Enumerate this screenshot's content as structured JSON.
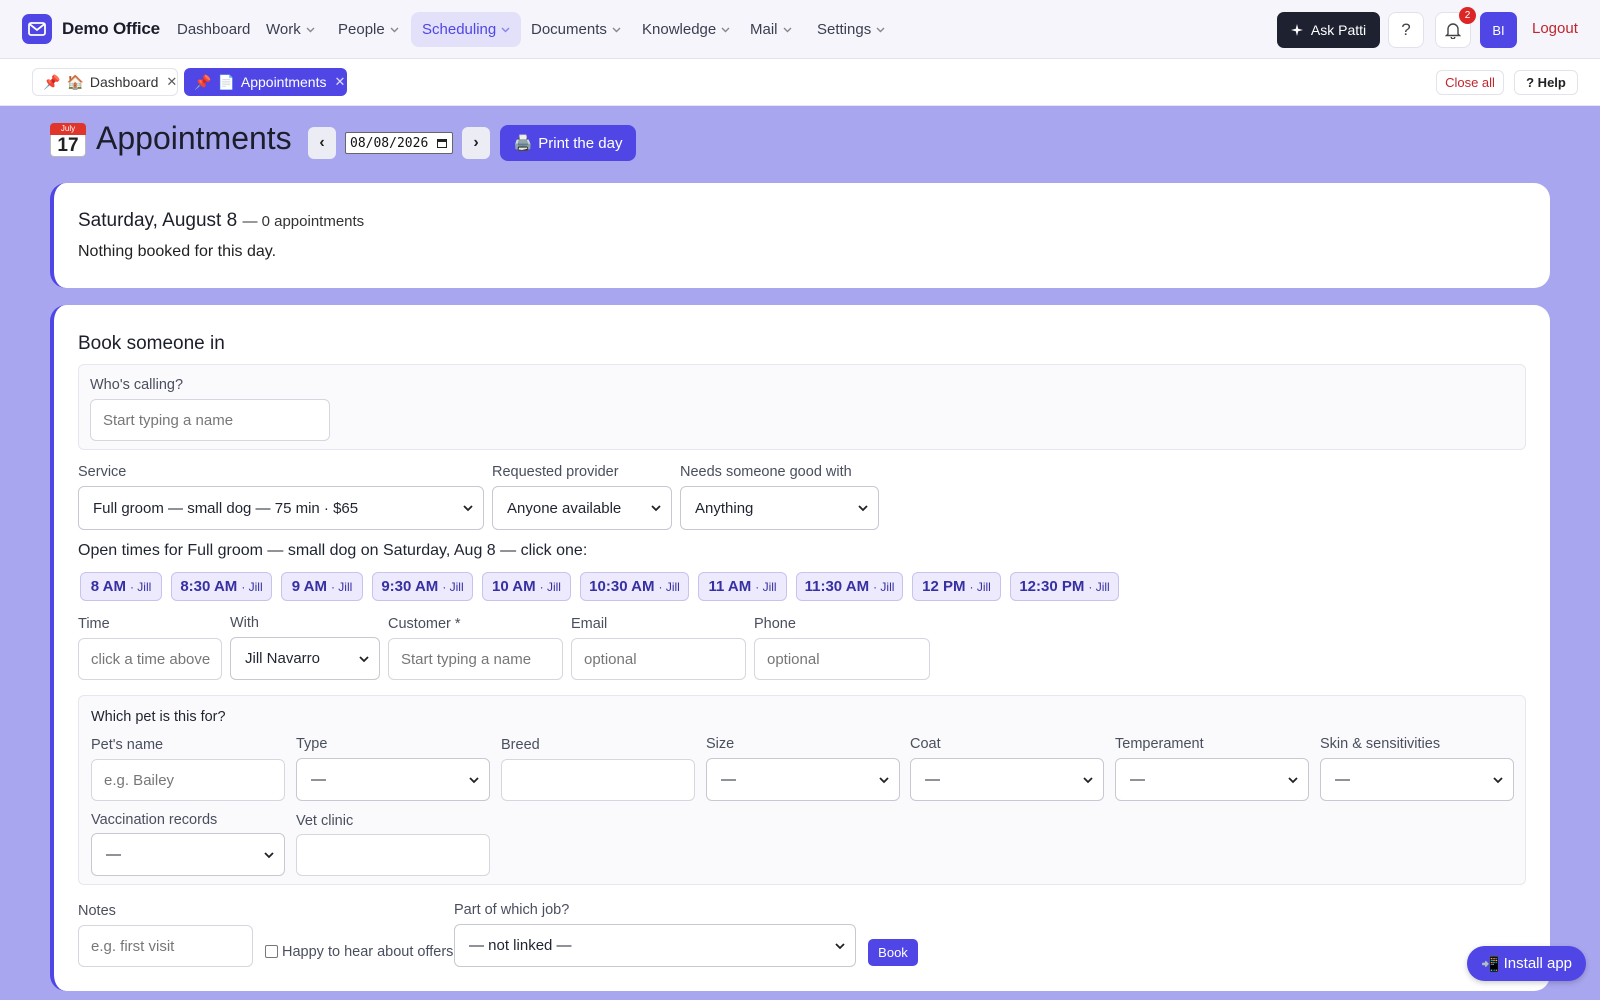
{
  "brand": {
    "name": "Demo Office"
  },
  "nav": {
    "items": [
      {
        "label": "Dashboard",
        "has_menu": false
      },
      {
        "label": "Work",
        "has_menu": true
      },
      {
        "label": "People",
        "has_menu": true
      },
      {
        "label": "Scheduling",
        "has_menu": true,
        "active": true
      },
      {
        "label": "Documents",
        "has_menu": true
      },
      {
        "label": "Knowledge",
        "has_menu": true
      },
      {
        "label": "Mail",
        "has_menu": true
      },
      {
        "label": "Settings",
        "has_menu": true
      }
    ],
    "ask_label": "Ask Patti",
    "help_glyph": "?",
    "notification_count": "2",
    "avatar_initials": "BI",
    "logout_label": "Logout"
  },
  "tabs": {
    "items": [
      {
        "pin": "📌",
        "icon": "🏠",
        "label": "Dashboard",
        "close": "✕"
      },
      {
        "pin": "📌",
        "icon": "📄",
        "label": "Appointments",
        "close": "✕",
        "active": true
      }
    ],
    "close_all_label": "Close all",
    "help_label": "? Help"
  },
  "header": {
    "cal_month": "July",
    "cal_day": "17",
    "title": "Appointments",
    "prev": "‹",
    "next": "›",
    "date_value": "08/08/2026",
    "print_icon": "🖨️",
    "print_label": "Print the day"
  },
  "day_summary": {
    "date": "Saturday, August 8",
    "count": "— 0 appointments",
    "empty_text": "Nothing booked for this day."
  },
  "booking": {
    "title": "Book someone in",
    "caller_label": "Who's calling?",
    "caller_placeholder": "Start typing a name",
    "service_label": "Service",
    "service_value": "Full groom — small dog — 75 min · $65",
    "provider_label": "Requested provider",
    "provider_value": "Anyone available",
    "needs_label": "Needs someone good with",
    "needs_value": "Anything",
    "open_times_text": "Open times for Full groom — small dog on Saturday, Aug 8 — click one:",
    "slots": [
      {
        "time": "8 AM",
        "who": "· Jill"
      },
      {
        "time": "8:30 AM",
        "who": "· Jill"
      },
      {
        "time": "9 AM",
        "who": "· Jill"
      },
      {
        "time": "9:30 AM",
        "who": "· Jill"
      },
      {
        "time": "10 AM",
        "who": "· Jill"
      },
      {
        "time": "10:30 AM",
        "who": "· Jill"
      },
      {
        "time": "11 AM",
        "who": "· Jill"
      },
      {
        "time": "11:30 AM",
        "who": "· Jill"
      },
      {
        "time": "12 PM",
        "who": "· Jill"
      },
      {
        "time": "12:30 PM",
        "who": "· Jill"
      }
    ],
    "time_label": "Time",
    "time_placeholder": "click a time above",
    "with_label": "With",
    "with_value": "Jill Navarro",
    "customer_label": "Customer *",
    "customer_placeholder": "Start typing a name",
    "email_label": "Email",
    "email_placeholder": "optional",
    "phone_label": "Phone",
    "phone_placeholder": "optional",
    "pet": {
      "title": "Which pet is this for?",
      "name_label": "Pet's name",
      "name_placeholder": "e.g. Bailey",
      "type_label": "Type",
      "breed_label": "Breed",
      "size_label": "Size",
      "coat_label": "Coat",
      "temperament_label": "Temperament",
      "skin_label": "Skin & sensitivities",
      "vacc_label": "Vaccination records",
      "vet_label": "Vet clinic",
      "empty_option": "—"
    },
    "notes_label": "Notes",
    "notes_placeholder": "e.g. first visit",
    "offers_label": "Happy to hear about offers",
    "job_label": "Part of which job?",
    "job_value": "— not linked —",
    "book_label": "Book"
  },
  "install": {
    "icon": "📲",
    "label": "Install app"
  },
  "colors": {
    "accent": "#4f46e5",
    "page_bg": "#a9a6f0",
    "danger": "#c0262d"
  }
}
